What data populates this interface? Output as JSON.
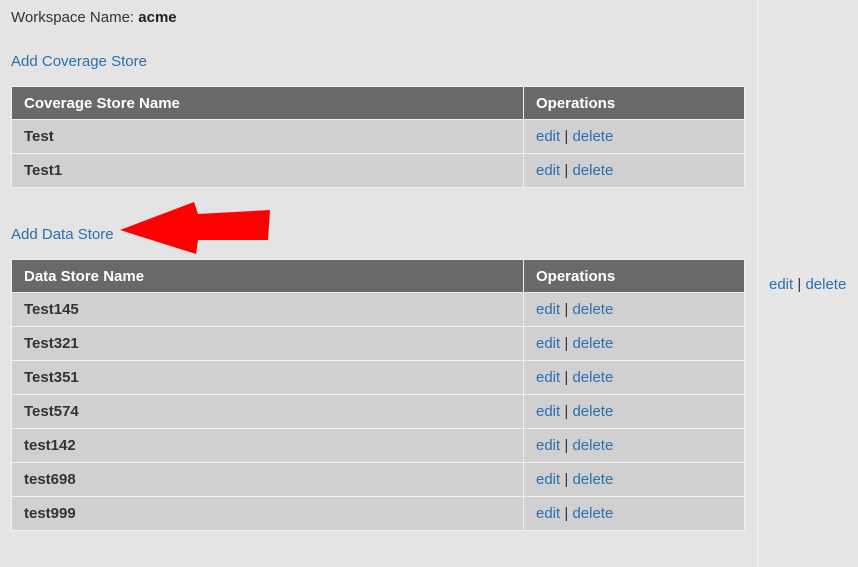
{
  "workspace": {
    "label": "Workspace Name:",
    "name": "acme"
  },
  "coverage": {
    "add_link": "Add Coverage Store",
    "headers": [
      "Coverage Store Name",
      "Operations"
    ],
    "rows": [
      "Test",
      "Test1"
    ]
  },
  "datastore": {
    "add_link": "Add Data Store",
    "headers": [
      "Data Store Name",
      "Operations"
    ],
    "rows": [
      "Test145",
      "Test321",
      "Test351",
      "Test574",
      "test142",
      "test698",
      "test999"
    ]
  },
  "ops": {
    "edit": "edit",
    "separator": "|",
    "delete": "delete"
  },
  "colors": {
    "link": "#2a6fb0",
    "header_bg": "#696969",
    "row_bg": "#d0d0d0",
    "arrow": "#ff0000"
  }
}
